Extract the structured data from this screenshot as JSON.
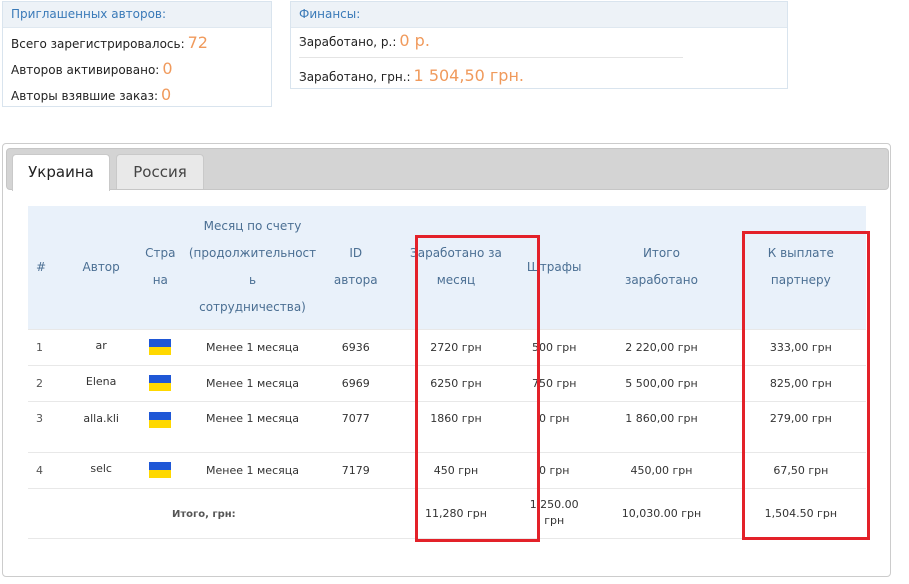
{
  "invited_panel": {
    "title": "Приглашенных авторов:",
    "rows": [
      {
        "label": "Всего зарегистрировалось:",
        "value": "72"
      },
      {
        "label": "Авторов активировано:",
        "value": "0"
      },
      {
        "label": "Авторы взявшие заказ:",
        "value": "0"
      }
    ]
  },
  "finance_panel": {
    "title": "Финансы:",
    "rows": [
      {
        "label": "Заработано, р.:",
        "value": "0 р."
      },
      {
        "label": "Заработано, грн.:",
        "value": "1 504,50 грн."
      }
    ]
  },
  "tabs": [
    {
      "label": "Украина",
      "active": true
    },
    {
      "label": "Россия",
      "active": false
    }
  ],
  "table": {
    "headers": [
      "#",
      "Автор",
      "Страна",
      "Месяц по счету (продолжительность сотрудничества)",
      "ID автора",
      "Заработано за месяц",
      "Штрафы",
      "Итого заработано",
      "К выплате партнеру"
    ],
    "header_lines": {
      "country": [
        "Стра",
        "на"
      ],
      "month": [
        "Месяц по счету",
        "(продолжительност",
        "ь",
        "сотрудничества)"
      ],
      "id": [
        "ID",
        "автора"
      ],
      "earned": [
        "Заработано за",
        "месяц"
      ],
      "total": [
        "Итого",
        "заработано"
      ],
      "payout": [
        "К выплате",
        "партнеру"
      ]
    },
    "rows": [
      {
        "n": "1",
        "author": "ar",
        "country_flag": "ukraine-flag-icon",
        "month": "Менее 1 месяца",
        "id": "6936",
        "earned": "2720 грн",
        "fines": "500 грн",
        "total": "2 220,00 грн",
        "payout": "333,00 грн"
      },
      {
        "n": "2",
        "author": "Elena",
        "country_flag": "ukraine-flag-icon",
        "month": "Менее 1 месяца",
        "id": "6969",
        "earned": "6250 грн",
        "fines": "750 грн",
        "total": "5 500,00 грн",
        "payout": "825,00 грн"
      },
      {
        "n": "3",
        "author": "alla.kli",
        "country_flag": "ukraine-flag-icon",
        "month": "Менее 1 месяца",
        "id": "7077",
        "earned": "1860 грн",
        "fines": "0 грн",
        "total": "1 860,00 грн",
        "payout": "279,00 грн"
      },
      {
        "n": "4",
        "author": "selc",
        "country_flag": "ukraine-flag-icon",
        "month": "Менее 1 месяца",
        "id": "7179",
        "earned": "450 грн",
        "fines": "0 грн",
        "total": "450,00 грн",
        "payout": "67,50 грн"
      }
    ],
    "totals": {
      "label": "Итого, грн:",
      "earned": "11,280 грн",
      "fines": "1,250.00 грн",
      "total": "10,030.00 грн",
      "payout": "1,504.50 грн"
    }
  },
  "colors": {
    "accent": "#3a7ab8",
    "value": "#f09a5c",
    "highlight": "#e32129",
    "header_bg": "#e9f1fa",
    "flag_blue": "#1f57d6",
    "flag_yellow": "#ffd800"
  }
}
